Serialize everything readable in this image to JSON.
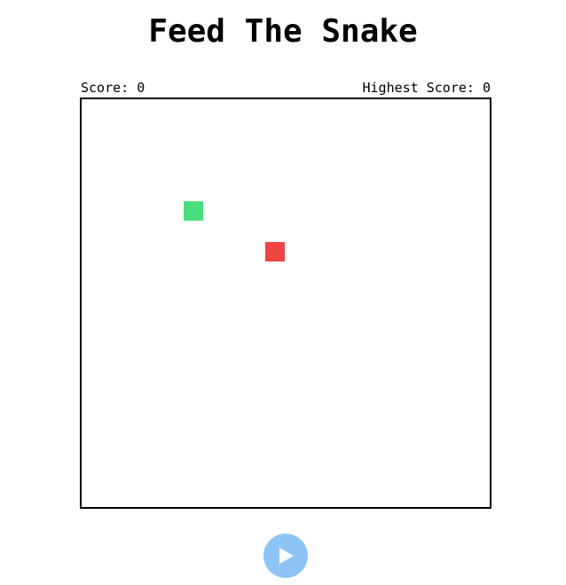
{
  "header": {
    "title": "Feed The Snake"
  },
  "scores": {
    "score_label": "Score: 0",
    "score_value": 0,
    "highest_label": "Highest Score: 0",
    "highest_value": 0
  },
  "board": {
    "snake_color": "#4ade80",
    "food_color": "#ef4444",
    "border_color": "#000000"
  },
  "controls": {
    "play_icon": "play-icon",
    "play_button_color": "#8ec5f6"
  }
}
